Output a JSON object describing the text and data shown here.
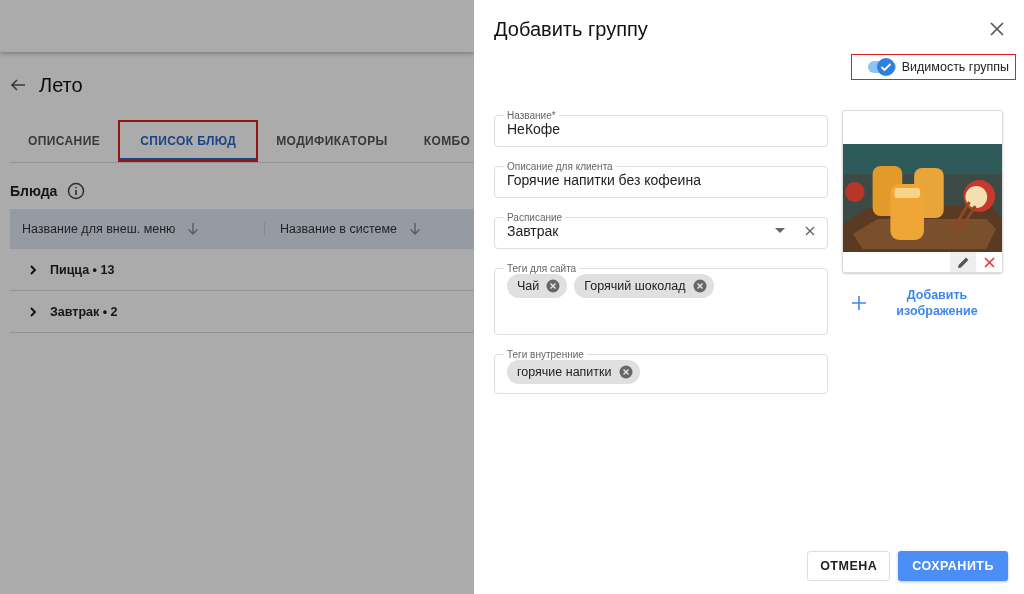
{
  "page": {
    "title": "Лето",
    "tabs": [
      {
        "label": "ОПИСАНИЕ",
        "selected": false,
        "highlighted": false
      },
      {
        "label": "СПИСОК БЛЮД",
        "selected": true,
        "highlighted": true
      },
      {
        "label": "МОДИФИКАТОРЫ",
        "selected": false,
        "highlighted": false
      },
      {
        "label": "КОМБО",
        "selected": false,
        "highlighted": false
      }
    ],
    "section_title": "Блюда",
    "table": {
      "columns": [
        "Название для внеш. меню",
        "Название в системе"
      ],
      "groups": [
        {
          "label": "Пицца • 13",
          "expanded": false
        },
        {
          "label": "Завтрак • 2",
          "expanded": false
        }
      ]
    }
  },
  "drawer": {
    "title": "Добавить группу",
    "visibility": {
      "label": "Видимость группы",
      "on": true,
      "highlighted": true
    },
    "fields": [
      {
        "kind": "text",
        "label": "Название*",
        "value": "НеКофе"
      },
      {
        "kind": "text",
        "label": "Описание для клиента",
        "value": "Горячие напитки без кофеина"
      },
      {
        "kind": "select",
        "label": "Расписание",
        "value": "Завтрак"
      },
      {
        "kind": "tags",
        "label": "Теги для сайта",
        "tags": [
          "Чай",
          "Горячий шоколад"
        ]
      },
      {
        "kind": "tags",
        "label": "Теги внутренние",
        "tags": [
          "горячие напитки"
        ]
      }
    ],
    "add_image": "Добавить изображение",
    "buttons": [
      {
        "label": "ОТМЕНА",
        "kind": "secondary"
      },
      {
        "label": "СОХРАНИТЬ",
        "kind": "primary"
      }
    ]
  }
}
